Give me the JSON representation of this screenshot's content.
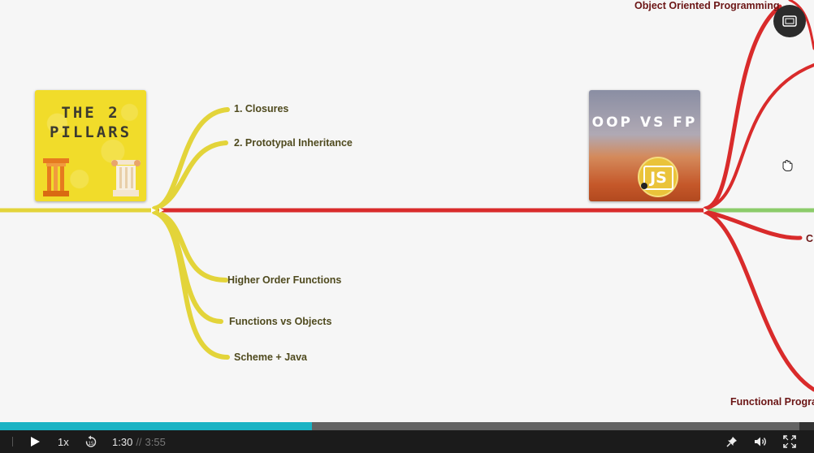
{
  "mindmap": {
    "left_branch": {
      "items": [
        "1. Closures",
        "2. Prototypal Inheritance",
        "Higher Order Functions",
        "Functions vs Objects",
        "Scheme + Java"
      ],
      "color": "#e3d43a"
    },
    "right_branch": {
      "top_label": "Object Oriented Programming",
      "bottom_label": "Functional Progra",
      "side_label": "C",
      "color": "#d92b2b"
    },
    "thumbnail_left": {
      "title_line1": "THE 2",
      "title_line2": "PILLARS",
      "icon": "column-icon"
    },
    "thumbnail_right": {
      "title": "OOP VS FP",
      "badge": "JS"
    },
    "green_line_color": "#8ccc6a"
  },
  "overlay": {
    "pip_icon": "picture-in-picture-icon",
    "cursor_icon": "grab-hand-icon"
  },
  "player": {
    "progress_fraction": 0.383,
    "progress_color": "#1ab3c4",
    "speed": "1x",
    "rewind_seconds": "15",
    "current_time": "1:30",
    "time_separator": "//",
    "total_time": "3:55",
    "icons": [
      "play-icon",
      "rewind-15-icon",
      "pin-icon",
      "volume-icon",
      "fullscreen-icon"
    ]
  }
}
